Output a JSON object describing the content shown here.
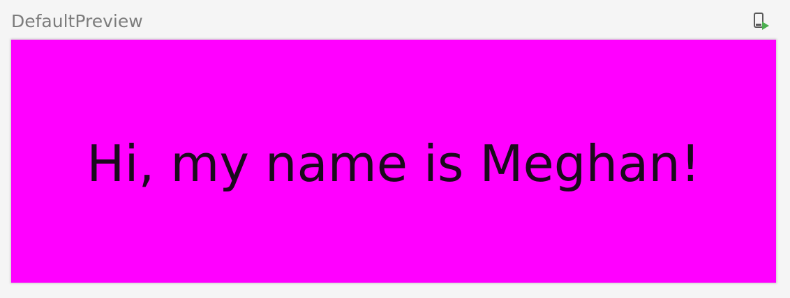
{
  "preview": {
    "title": "DefaultPreview",
    "background_color": "#ff00ff",
    "greeting": "Hi, my name is Meghan!"
  },
  "toolbar": {
    "run_icon": "deploy-to-device-icon",
    "icon_accent_color": "#4caf50"
  }
}
